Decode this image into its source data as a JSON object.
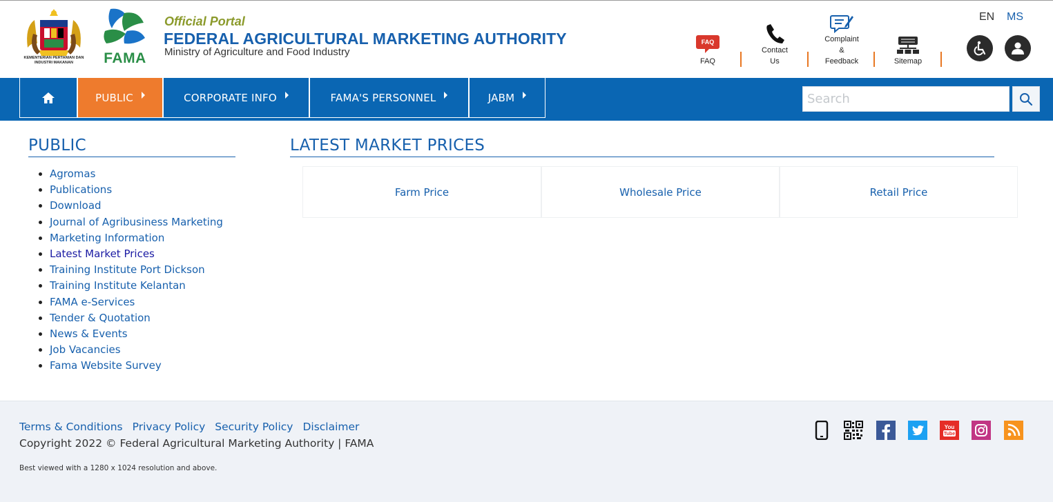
{
  "header": {
    "crest_caption": "KEMENTERIAN PERTANIAN DAN INDUSTRI MAKANAN",
    "logo_word": "FAMA",
    "portal_sub": "Official Portal",
    "portal_title": "FEDERAL AGRICULTURAL MARKETING AUTHORITY",
    "ministry": "Ministry of Agriculture and Food Industry",
    "tools": {
      "faq_badge": "FAQ",
      "faq": "FAQ",
      "contact_1": "Contact",
      "contact_2": "Us",
      "complaint_1": "Complaint",
      "complaint_2": "&",
      "complaint_3": "Feedback",
      "sitemap": "Sitemap"
    },
    "lang": {
      "en": "EN",
      "ms": "MS"
    }
  },
  "nav": {
    "items": [
      {
        "label": "PUBLIC"
      },
      {
        "label": "CORPORATE INFO"
      },
      {
        "label": "FAMA'S PERSONNEL"
      },
      {
        "label": "JABM"
      }
    ],
    "search_placeholder": "Search"
  },
  "sidebar": {
    "title": "PUBLIC",
    "items": [
      "Agromas",
      "Publications",
      "Download",
      "Journal of Agribusiness Marketing",
      "Marketing Information",
      "Latest Market Prices",
      "Training Institute Port Dickson",
      "Training Institute Kelantan",
      "FAMA e-Services",
      "Tender & Quotation",
      "News & Events",
      "Job Vacancies",
      "Fama Website Survey"
    ]
  },
  "main": {
    "title": "LATEST MARKET PRICES",
    "prices": [
      "Farm Price",
      "Wholesale Price",
      "Retail Price"
    ]
  },
  "footer": {
    "links": [
      "Terms & Conditions",
      "Privacy Policy",
      "Security Policy",
      "Disclaimer"
    ],
    "copyright": "Copyright 2022 © Federal Agricultural Marketing Authority | FAMA",
    "best_viewed": "Best viewed with a 1280 x 1024 resolution and above.",
    "social": [
      "mobile-icon",
      "qr-code-icon",
      "facebook-icon",
      "twitter-icon",
      "youtube-icon",
      "instagram-icon",
      "rss-icon"
    ]
  },
  "colors": {
    "brand_blue": "#0a66b3",
    "active_orange": "#ee7b2d",
    "link_blue": "#1760ad"
  }
}
